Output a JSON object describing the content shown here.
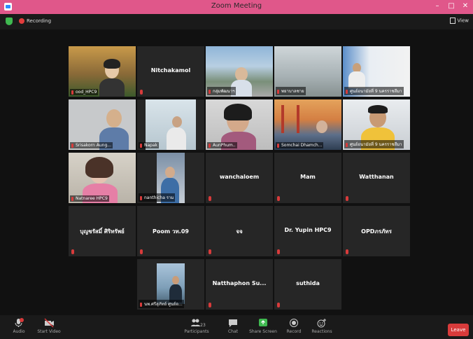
{
  "window": {
    "title": "Zoom Meeting"
  },
  "topbar": {
    "recording_label": "Recording",
    "view_label": "View"
  },
  "tiles": [
    {
      "label": "ood_HPC9",
      "kind": "video"
    },
    {
      "label": "Nitchakamol",
      "kind": "name"
    },
    {
      "label": "กลุ่มพัฒนาฯ",
      "kind": "video"
    },
    {
      "label": "พยาบาลชาย",
      "kind": "video"
    },
    {
      "label": "ศูนย์อนามัยที่ 9 นครราชสีมา",
      "kind": "video"
    },
    {
      "label": "Srisakorn Aung...",
      "kind": "video"
    },
    {
      "label": "Napak",
      "kind": "video"
    },
    {
      "label": "AunPhum..",
      "kind": "video"
    },
    {
      "label": "Somchai Dhamch...",
      "kind": "video"
    },
    {
      "label": "ศูนย์อนามัยที่ 9 นครราชสีมา",
      "kind": "video"
    },
    {
      "label": "Natnaree HPC9",
      "kind": "video"
    },
    {
      "label": "nanthicha ราม",
      "kind": "video"
    },
    {
      "label": "wanchaloem",
      "kind": "name"
    },
    {
      "label": "Mam",
      "kind": "name"
    },
    {
      "label": "Watthanan",
      "kind": "name"
    },
    {
      "label": "บุญชรัสมิ์ ศิริทรัพย์",
      "kind": "name"
    },
    {
      "label": "Poom วท.09",
      "kind": "name"
    },
    {
      "label": "จจ",
      "kind": "name"
    },
    {
      "label": "Dr. Yupin HPC9",
      "kind": "name"
    },
    {
      "label": "OPDภรภัทร",
      "kind": "name"
    },
    {
      "label": "นพ.ศรีสุภัทย์ ศูนย์อ...",
      "kind": "video"
    },
    {
      "label": "Natthaphon Su...",
      "kind": "name"
    },
    {
      "label": "suthida",
      "kind": "name"
    }
  ],
  "toolbar": {
    "audio": "Audio",
    "start_video": "Start Video",
    "participants": "Participants",
    "participants_count": "23",
    "chat": "Chat",
    "share_screen": "Share Screen",
    "record": "Record",
    "reactions": "Reactions",
    "leave": "Leave"
  },
  "colors": {
    "titlebar": "#e0578a",
    "accent_green": "#3fb950",
    "leave": "#d83b3b",
    "active_speaker": "#e6d86a"
  }
}
